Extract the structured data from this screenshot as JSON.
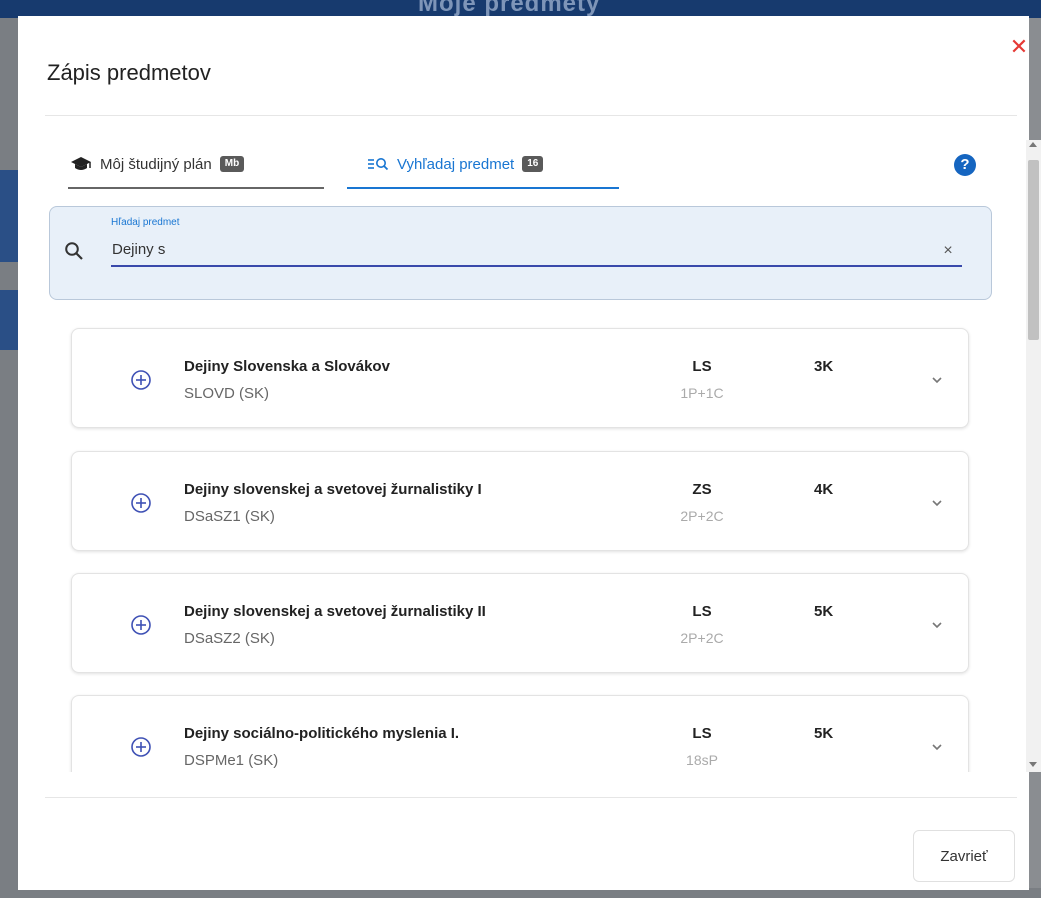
{
  "background": {
    "header_text": "Moje predmety"
  },
  "dialog": {
    "title": "Zápis predmetov",
    "close_label": "Zavrieť",
    "accent_color": "#1976d2",
    "close_icon_color": "#e53935"
  },
  "tabs": [
    {
      "label": "Môj študijný plán",
      "badge": "Mb",
      "icon": "graduation-cap-icon",
      "active": false
    },
    {
      "label": "Vyhľadaj predmet",
      "badge": "16",
      "icon": "list-search-icon",
      "active": true
    }
  ],
  "search": {
    "label": "Hľadaj predmet",
    "value": "Dejiny s"
  },
  "courses": [
    {
      "name": "Dejiny Slovenska a Slovákov",
      "code": "SLOVD (SK)",
      "semester": "LS",
      "hours": "1P+1C",
      "credits": "3K"
    },
    {
      "name": "Dejiny slovenskej a svetovej žurnalistiky I",
      "code": "DSaSZ1 (SK)",
      "semester": "ZS",
      "hours": "2P+2C",
      "credits": "4K"
    },
    {
      "name": "Dejiny slovenskej a svetovej žurnalistiky II",
      "code": "DSaSZ2 (SK)",
      "semester": "LS",
      "hours": "2P+2C",
      "credits": "5K"
    },
    {
      "name": "Dejiny sociálno-politického myslenia I.",
      "code": "DSPMe1 (SK)",
      "semester": "LS",
      "hours": "18sP",
      "credits": "5K"
    }
  ]
}
